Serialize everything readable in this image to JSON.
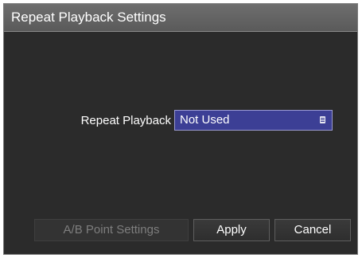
{
  "dialog": {
    "title": "Repeat Playback Settings"
  },
  "repeat_playback": {
    "label": "Repeat Playback",
    "value": "Not Used",
    "icon": "list-icon"
  },
  "buttons": {
    "ab_point_settings": "A/B Point Settings",
    "ab_point_settings_enabled": false,
    "apply": "Apply",
    "cancel": "Cancel"
  },
  "colors": {
    "dialog_background": "#2b2b2b",
    "titlebar": "#626262",
    "select_background": "#3c3f95",
    "text": "#ffffff",
    "disabled_text": "#7e7e7e"
  }
}
